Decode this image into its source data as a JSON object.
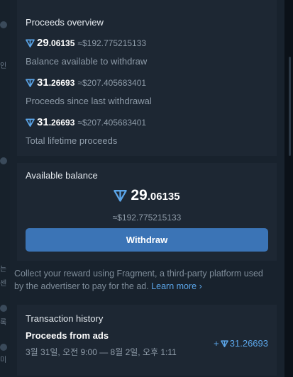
{
  "overview": {
    "title": "Proceeds overview",
    "rows": [
      {
        "int": "29",
        "dec": ".06135",
        "usd": "≈$192.775215133",
        "label": "Balance available to withdraw"
      },
      {
        "int": "31",
        "dec": ".26693",
        "usd": "≈$207.405683401",
        "label": "Proceeds since last withdrawal"
      },
      {
        "int": "31",
        "dec": ".26693",
        "usd": "≈$207.405683401",
        "label": "Total lifetime proceeds"
      }
    ]
  },
  "balance": {
    "title": "Available balance",
    "int": "29",
    "dec": ".06135",
    "usd": "≈$192.775215133",
    "withdraw_label": "Withdraw"
  },
  "info": {
    "text": "Collect your reward using Fragment, a third-party platform used by the advertiser to pay for the ad.",
    "learn_more": "Learn more ›"
  },
  "history": {
    "title": "Transaction history",
    "item": {
      "name": "Proceeds from ads",
      "date": "3월 31일, 오전 9:00 — 8월 2일, 오후 1:11",
      "amount_prefix": "+",
      "amount": "31.26693"
    }
  },
  "colors": {
    "accent": "#3b74b6",
    "link": "#5ba5e8",
    "ton": "#5ba5e8"
  }
}
